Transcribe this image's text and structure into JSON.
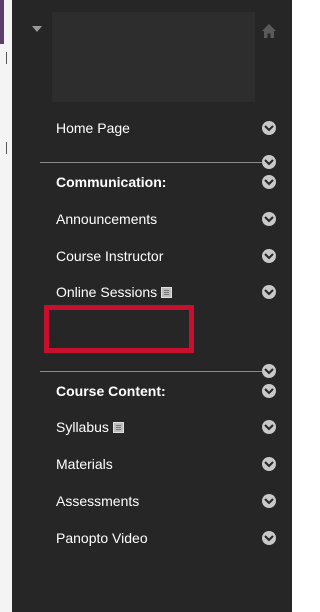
{
  "menu": {
    "items": [
      {
        "id": "home-page",
        "label": "Home Page",
        "type": "link"
      },
      {
        "id": "communication",
        "label": "Communication:",
        "type": "header"
      },
      {
        "id": "announcements",
        "label": "Announcements",
        "type": "link"
      },
      {
        "id": "course-instructor",
        "label": "Course Instructor",
        "type": "link"
      },
      {
        "id": "online-sessions",
        "label": "Online Sessions",
        "type": "link",
        "badge_icon": "content-item-icon",
        "highlighted": true
      },
      {
        "id": "course-content",
        "label": "Course Content:",
        "type": "header"
      },
      {
        "id": "syllabus",
        "label": "Syllabus",
        "type": "link",
        "badge_icon": "content-item-icon"
      },
      {
        "id": "materials",
        "label": "Materials",
        "type": "link"
      },
      {
        "id": "assessments",
        "label": "Assessments",
        "type": "link"
      },
      {
        "id": "panopto-video",
        "label": "Panopto Video",
        "type": "link"
      }
    ]
  },
  "icons": {
    "collapse": "caret-down-icon",
    "home": "home-icon",
    "item_options": "chevron-down-circle-icon"
  },
  "colors": {
    "panel_background": "#262626",
    "text": "#ffffff",
    "highlight_border": "#c8102e",
    "chevron_circle": "#c8c8c8"
  }
}
